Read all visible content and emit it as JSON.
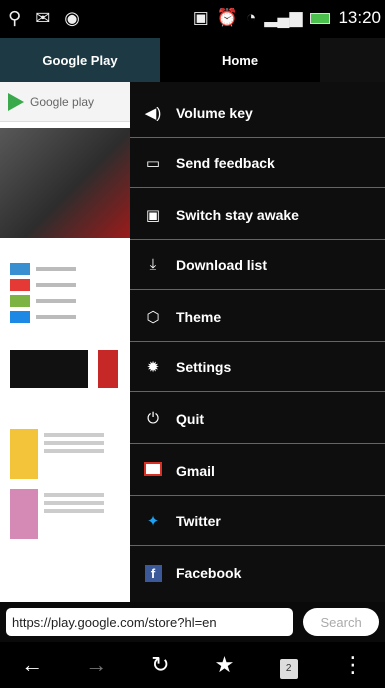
{
  "status": {
    "time": "13:20"
  },
  "tabs": [
    {
      "label": "Google Play"
    },
    {
      "label": "Home"
    }
  ],
  "web": {
    "logo_text": "Google play"
  },
  "menu": {
    "items": [
      {
        "label": "Volume key",
        "icon": "speaker-icon"
      },
      {
        "label": "Send feedback",
        "icon": "feedback-icon"
      },
      {
        "label": "Switch stay awake",
        "icon": "screen-icon"
      },
      {
        "label": "Download list",
        "icon": "download-icon"
      },
      {
        "label": "Theme",
        "icon": "theme-icon"
      },
      {
        "label": "Settings",
        "icon": "gear-icon"
      },
      {
        "label": "Quit",
        "icon": "power-icon"
      },
      {
        "label": "Gmail",
        "icon": "gmail-icon"
      },
      {
        "label": "Twitter",
        "icon": "twitter-icon"
      },
      {
        "label": "Facebook",
        "icon": "facebook-icon"
      }
    ]
  },
  "address": {
    "url": "https://play.google.com/store?hl=en",
    "search_label": "Search"
  },
  "toolbar": {
    "tab_count": "2"
  },
  "colors": {
    "menu_divider": "#4a6f78",
    "tab_active": "#1d3a44"
  }
}
